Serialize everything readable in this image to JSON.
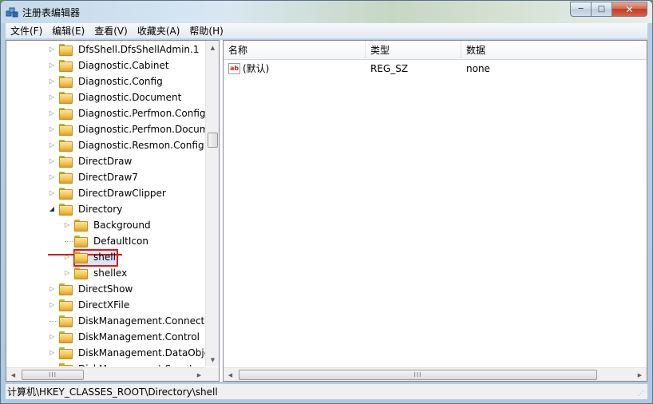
{
  "window": {
    "title": "注册表编辑器",
    "controls": {
      "minimize": "─",
      "maximize": "□",
      "close": "✕"
    }
  },
  "menu": [
    "文件(F)",
    "编辑(E)",
    "查看(V)",
    "收藏夹(A)",
    "帮助(H)"
  ],
  "tree": {
    "items": [
      {
        "label": "DfsShell.DfsShellAdmin.1",
        "level": 0,
        "state": "collapsed"
      },
      {
        "label": "Diagnostic.Cabinet",
        "level": 0,
        "state": "collapsed"
      },
      {
        "label": "Diagnostic.Config",
        "level": 0,
        "state": "collapsed"
      },
      {
        "label": "Diagnostic.Document",
        "level": 0,
        "state": "collapsed"
      },
      {
        "label": "Diagnostic.Perfmon.Config",
        "level": 0,
        "state": "collapsed"
      },
      {
        "label": "Diagnostic.Perfmon.Document",
        "level": 0,
        "state": "collapsed"
      },
      {
        "label": "Diagnostic.Resmon.Config",
        "level": 0,
        "state": "collapsed"
      },
      {
        "label": "DirectDraw",
        "level": 0,
        "state": "collapsed"
      },
      {
        "label": "DirectDraw7",
        "level": 0,
        "state": "collapsed"
      },
      {
        "label": "DirectDrawClipper",
        "level": 0,
        "state": "collapsed"
      },
      {
        "label": "Directory",
        "level": 0,
        "state": "expanded"
      },
      {
        "label": "Background",
        "level": 1,
        "state": "collapsed"
      },
      {
        "label": "DefaultIcon",
        "level": 1,
        "state": "none"
      },
      {
        "label": "shell",
        "level": 1,
        "state": "collapsed",
        "selected": true
      },
      {
        "label": "shellex",
        "level": 1,
        "state": "collapsed"
      },
      {
        "label": "DirectShow",
        "level": 0,
        "state": "collapsed"
      },
      {
        "label": "DirectXFile",
        "level": 0,
        "state": "collapsed"
      },
      {
        "label": "DiskManagement.Connection",
        "level": 0,
        "state": "none"
      },
      {
        "label": "DiskManagement.Control",
        "level": 0,
        "state": "collapsed"
      },
      {
        "label": "DiskManagement.DataObject",
        "level": 0,
        "state": "collapsed"
      },
      {
        "label": "DiskManagement.SnapIn",
        "level": 0,
        "state": "collapsed"
      }
    ]
  },
  "list": {
    "columns": [
      "名称",
      "类型",
      "数据"
    ],
    "rows": [
      {
        "name": "(默认)",
        "type": "REG_SZ",
        "data": "none"
      }
    ]
  },
  "scrollbar": {
    "thumb_glyph": "III"
  },
  "status": {
    "path": "计算机\\HKEY_CLASSES_ROOT\\Directory\\shell"
  },
  "colors": {
    "highlight_box": "#e0161c",
    "selection_bg": "#dbe7f6"
  }
}
